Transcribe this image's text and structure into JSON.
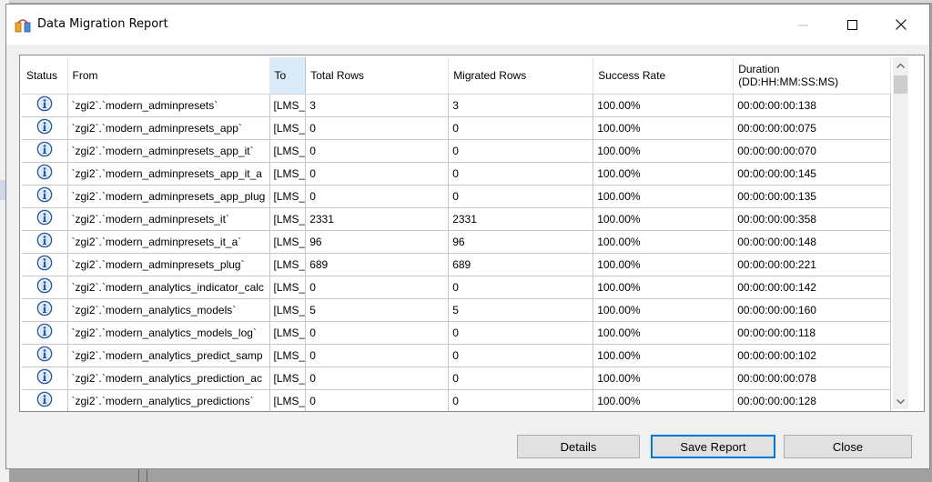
{
  "window": {
    "title": "Data Migration Report",
    "controls": {
      "minimize": "minimize",
      "maximize": "maximize",
      "close": "close"
    }
  },
  "grid": {
    "columns": [
      {
        "key": "status",
        "label": "Status"
      },
      {
        "key": "from",
        "label": "From"
      },
      {
        "key": "to",
        "label": "To"
      },
      {
        "key": "total",
        "label": "Total Rows"
      },
      {
        "key": "migrated",
        "label": "Migrated Rows"
      },
      {
        "key": "success",
        "label": "Success Rate"
      },
      {
        "key": "duration",
        "label": "Duration",
        "sublabel": "(DD:HH:MM:SS:MS)"
      }
    ],
    "selected_column": "to",
    "status_icon": "info-icon",
    "rows": [
      {
        "from": "`zgi2`.`modern_adminpresets`",
        "to": "[LMS_",
        "total": "3",
        "migrated": "3",
        "success": "100.00%",
        "duration": "00:00:00:00:138"
      },
      {
        "from": "`zgi2`.`modern_adminpresets_app`",
        "to": "[LMS_",
        "total": "0",
        "migrated": "0",
        "success": "100.00%",
        "duration": "00:00:00:00:075"
      },
      {
        "from": "`zgi2`.`modern_adminpresets_app_it`",
        "to": "[LMS_",
        "total": "0",
        "migrated": "0",
        "success": "100.00%",
        "duration": "00:00:00:00:070"
      },
      {
        "from": "`zgi2`.`modern_adminpresets_app_it_a",
        "to": "[LMS_",
        "total": "0",
        "migrated": "0",
        "success": "100.00%",
        "duration": "00:00:00:00:145"
      },
      {
        "from": "`zgi2`.`modern_adminpresets_app_plug",
        "to": "[LMS_",
        "total": "0",
        "migrated": "0",
        "success": "100.00%",
        "duration": "00:00:00:00:135"
      },
      {
        "from": "`zgi2`.`modern_adminpresets_it`",
        "to": "[LMS_",
        "total": "2331",
        "migrated": "2331",
        "success": "100.00%",
        "duration": "00:00:00:00:358"
      },
      {
        "from": "`zgi2`.`modern_adminpresets_it_a`",
        "to": "[LMS_",
        "total": "96",
        "migrated": "96",
        "success": "100.00%",
        "duration": "00:00:00:00:148"
      },
      {
        "from": "`zgi2`.`modern_adminpresets_plug`",
        "to": "[LMS_",
        "total": "689",
        "migrated": "689",
        "success": "100.00%",
        "duration": "00:00:00:00:221"
      },
      {
        "from": "`zgi2`.`modern_analytics_indicator_calc",
        "to": "[LMS_",
        "total": "0",
        "migrated": "0",
        "success": "100.00%",
        "duration": "00:00:00:00:142"
      },
      {
        "from": "`zgi2`.`modern_analytics_models`",
        "to": "[LMS_",
        "total": "5",
        "migrated": "5",
        "success": "100.00%",
        "duration": "00:00:00:00:160"
      },
      {
        "from": "`zgi2`.`modern_analytics_models_log`",
        "to": "[LMS_",
        "total": "0",
        "migrated": "0",
        "success": "100.00%",
        "duration": "00:00:00:00:118"
      },
      {
        "from": "`zgi2`.`modern_analytics_predict_samp",
        "to": "[LMS_",
        "total": "0",
        "migrated": "0",
        "success": "100.00%",
        "duration": "00:00:00:00:102"
      },
      {
        "from": "`zgi2`.`modern_analytics_prediction_ac",
        "to": "[LMS_",
        "total": "0",
        "migrated": "0",
        "success": "100.00%",
        "duration": "00:00:00:00:078"
      },
      {
        "from": "`zgi2`.`modern_analytics_predictions`",
        "to": "[LMS_",
        "total": "0",
        "migrated": "0",
        "success": "100.00%",
        "duration": "00:00:00:00:128"
      }
    ]
  },
  "buttons": {
    "details": "Details",
    "save_report": "Save Report",
    "close": "Close"
  },
  "colors": {
    "selected_header": "#d9ebf9",
    "default_button_border": "#0078d7",
    "info_icon": "#1e5aa8"
  }
}
